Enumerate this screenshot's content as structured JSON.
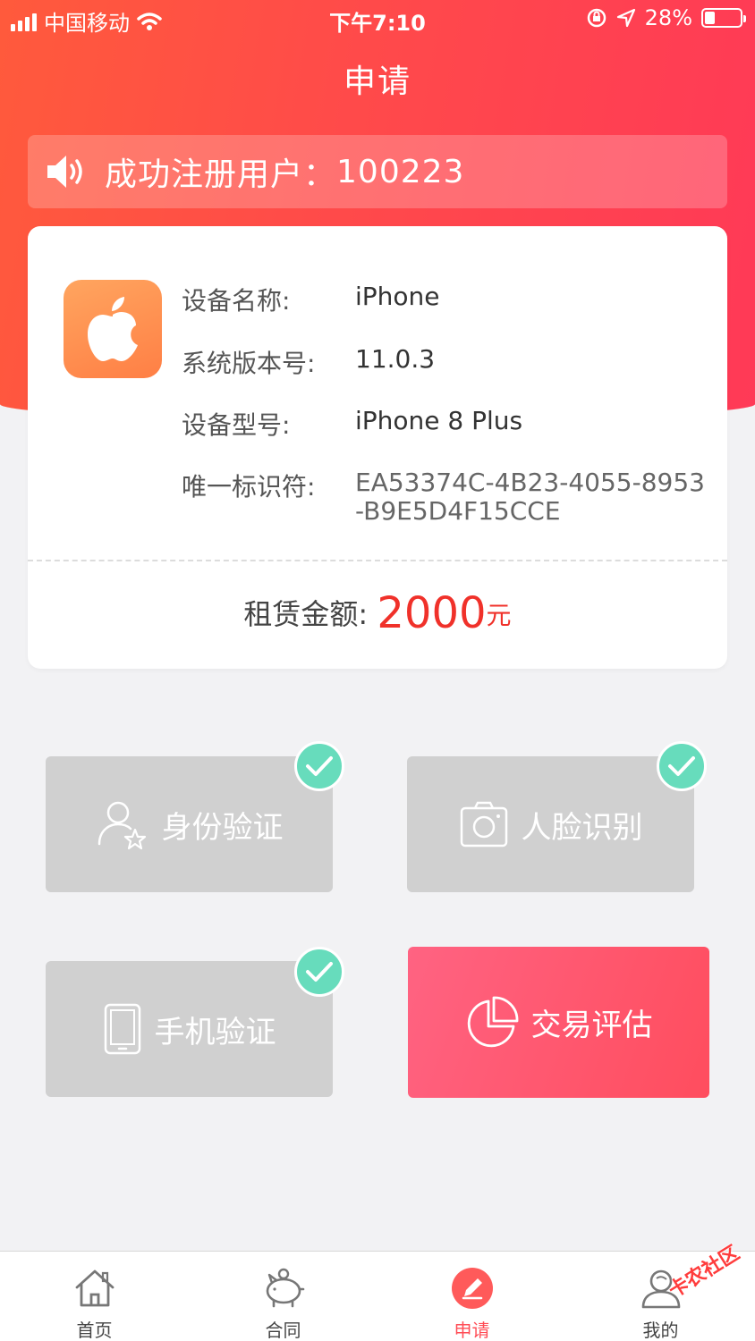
{
  "status_bar": {
    "carrier": "中国移动",
    "time": "下午7:10",
    "battery": "28%",
    "battery_level": 0.28
  },
  "nav": {
    "title": "申请"
  },
  "notice": {
    "label": "成功注册用户：",
    "value": "100223"
  },
  "device": {
    "rows": [
      {
        "key": "设备名称:",
        "value": "iPhone"
      },
      {
        "key": "系统版本号:",
        "value": "11.0.3"
      },
      {
        "key": "设备型号:",
        "value": "iPhone 8 Plus"
      },
      {
        "key": "唯一标识符:",
        "value": "EA53374C-4B23-4055-8953",
        "value2": "-B9E5D4F15CCE"
      }
    ],
    "amount_label": "租赁金额:",
    "amount_value": "2000",
    "amount_unit": "元"
  },
  "actions": [
    {
      "label": "身份验证",
      "done": true
    },
    {
      "label": "人脸识别",
      "done": true
    },
    {
      "label": "手机验证",
      "done": true
    },
    {
      "label": "交易评估",
      "done": false
    }
  ],
  "tabbar": {
    "items": [
      {
        "label": "首页",
        "icon": "home-icon"
      },
      {
        "label": "合同",
        "icon": "piggy-bank-icon"
      },
      {
        "label": "申请",
        "icon": "pencil-icon"
      },
      {
        "label": "我的",
        "icon": "user-icon"
      }
    ],
    "active_color": "#ff4d56"
  },
  "watermark": "卡农社区",
  "colors": {
    "header": "#ff4a4a",
    "amount": "#f0312a",
    "check": "#67dcbc",
    "tile_disabled": "#d0d0d0",
    "tile_active": "#ff5870"
  }
}
